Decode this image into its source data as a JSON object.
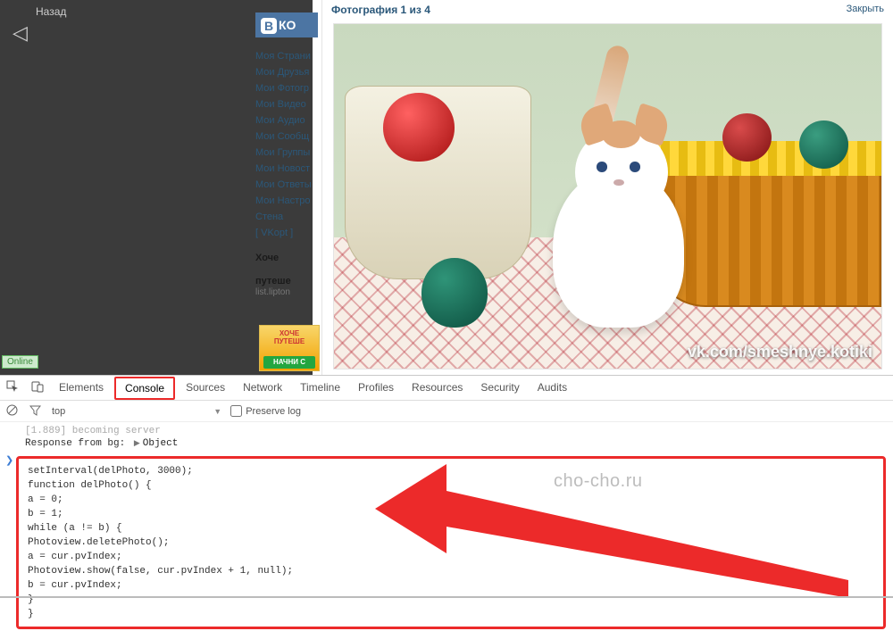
{
  "browser": {
    "back_label": "Назад"
  },
  "vk": {
    "logo_text": "В",
    "site_label": "КО",
    "sidebar": [
      "Моя Страни",
      "Мои Друзья",
      "Мои Фотогр",
      "Мои Видео",
      "Мои Аудио",
      "Мои Сообщ",
      "Мои Группы",
      "Мои Новост",
      "Мои Ответы",
      "Мои Настро",
      "Стена",
      "[ VKopt ]"
    ],
    "ad": {
      "headline1": "Хоче",
      "headline2": "путеше",
      "sub": "list.lipton",
      "banner_top": "ХОЧЕ",
      "banner_mid": "ПУТЕШЕ",
      "banner_btn": "НАЧНИ С"
    },
    "online_badge": "Online"
  },
  "viewer": {
    "title": "Фотография 1 из 4",
    "close": "Закрыть",
    "watermark": "vk.com/smeshnye.kotiki"
  },
  "devtools": {
    "tabs": [
      "Elements",
      "Console",
      "Sources",
      "Network",
      "Timeline",
      "Profiles",
      "Resources",
      "Security",
      "Audits"
    ],
    "active_tab": "Console",
    "toolbar": {
      "context": "top",
      "preserve_log_label": "Preserve log"
    },
    "log": {
      "old_line": "[1.889] becoming server",
      "response_label": "Response from bg:",
      "response_object": "Object"
    },
    "code": "setInterval(delPhoto, 3000);\nfunction delPhoto() {\na = 0;\nb = 1;\nwhile (a != b) {\nPhotoview.deletePhoto();\na = cur.pvIndex;\nPhotoview.show(false, cur.pvIndex + 1, null);\nb = cur.pvIndex;\n}\n}"
  },
  "annotation": {
    "watermark": "cho-cho.ru"
  }
}
